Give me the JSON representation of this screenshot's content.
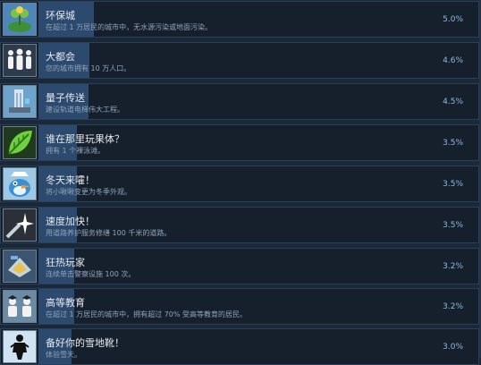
{
  "achievements": [
    {
      "title": "环保城",
      "description": "在超过 1 万居民的城市中，无水源污染或地面污染。",
      "percent": "5.0%",
      "fill": 0.05,
      "icon": "globe-plant-icon"
    },
    {
      "title": "大都会",
      "description": "您的城市拥有 10 万人口。",
      "percent": "4.6%",
      "fill": 0.046,
      "icon": "crowd-icon"
    },
    {
      "title": "量子传送",
      "description": "建设轨道电梯伟大工程。",
      "percent": "4.5%",
      "fill": 0.045,
      "icon": "tower-icon"
    },
    {
      "title": "谁在那里玩果体？",
      "description": "拥有 1 个裸泳滩。",
      "percent": "3.5%",
      "fill": 0.035,
      "icon": "leaf-icon"
    },
    {
      "title": "冬天来嚯！",
      "description": "将小啾啾变更为冬季外观。",
      "percent": "3.5%",
      "fill": 0.035,
      "icon": "snow-bird-icon"
    },
    {
      "title": "速度加快！",
      "description": "用道路养护服务修缮 100 千米的道路。",
      "percent": "3.5%",
      "fill": 0.035,
      "icon": "speed-flash-icon"
    },
    {
      "title": "狂热玩家",
      "description": "连续单击警察设施 100 次。",
      "percent": "3.2%",
      "fill": 0.032,
      "icon": "police-badge-icon"
    },
    {
      "title": "高等教育",
      "description": "在超过 1 万居民的城市中，拥有超过 70% 受高等教育的居民。",
      "percent": "3.2%",
      "fill": 0.032,
      "icon": "students-icon"
    },
    {
      "title": "备好你的雪地靴！",
      "description": "体验雪天。",
      "percent": "3.0%",
      "fill": 0.03,
      "icon": "snow-boots-icon"
    }
  ]
}
